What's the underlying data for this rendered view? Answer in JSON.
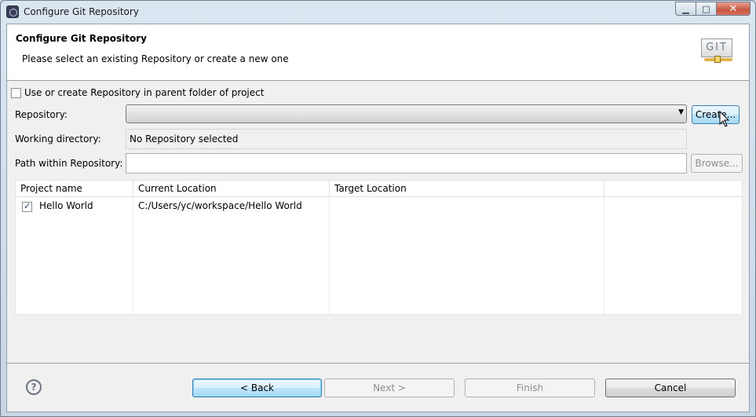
{
  "window": {
    "title": "Configure Git Repository"
  },
  "header": {
    "title": "Configure Git Repository",
    "description": "Please select an existing Repository or create a new one",
    "logo_text": "GIT"
  },
  "parent_folder": {
    "label": "Use or create Repository in parent folder of project",
    "checked": false
  },
  "repository": {
    "label": "Repository:",
    "selected": "",
    "create_button": "Create..."
  },
  "working_directory": {
    "label": "Working directory:",
    "value": "No Repository selected"
  },
  "path_within": {
    "label": "Path within Repository:",
    "value": "",
    "browse_button": "Browse..."
  },
  "projects_table": {
    "columns": [
      "Project name",
      "Current Location",
      "Target Location",
      ""
    ],
    "rows": [
      {
        "checked": true,
        "project_name": "Hello World",
        "current_location": "C:/Users/yc/workspace/Hello World",
        "target_location": ""
      }
    ]
  },
  "footer": {
    "help_icon": "help-icon",
    "back": "< Back",
    "next": "Next >",
    "finish": "Finish",
    "cancel": "Cancel"
  }
}
